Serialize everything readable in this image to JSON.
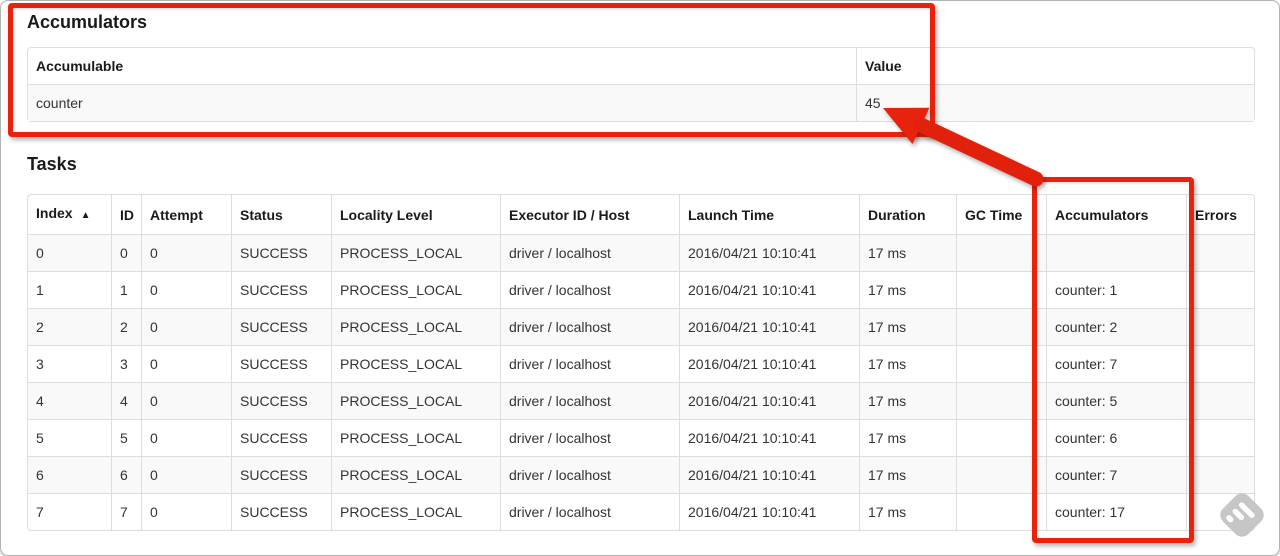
{
  "accumulators_section": {
    "title": "Accumulators",
    "table": {
      "headers": {
        "accumulable": "Accumulable",
        "value": "Value"
      },
      "row": {
        "accumulable": "counter",
        "value": "45"
      }
    }
  },
  "tasks_section": {
    "title": "Tasks",
    "table": {
      "columns": [
        "Index",
        "ID",
        "Attempt",
        "Status",
        "Locality Level",
        "Executor ID / Host",
        "Launch Time",
        "Duration",
        "GC Time",
        "Accumulators",
        "Errors"
      ],
      "sort_icon": "▲",
      "rows": [
        {
          "index": "0",
          "id": "0",
          "attempt": "0",
          "status": "SUCCESS",
          "locality": "PROCESS_LOCAL",
          "executor": "driver / localhost",
          "launch_time": "2016/04/21 10:10:41",
          "duration": "17 ms",
          "gc_time": "",
          "accumulators": "",
          "errors": ""
        },
        {
          "index": "1",
          "id": "1",
          "attempt": "0",
          "status": "SUCCESS",
          "locality": "PROCESS_LOCAL",
          "executor": "driver / localhost",
          "launch_time": "2016/04/21 10:10:41",
          "duration": "17 ms",
          "gc_time": "",
          "accumulators": "counter: 1",
          "errors": ""
        },
        {
          "index": "2",
          "id": "2",
          "attempt": "0",
          "status": "SUCCESS",
          "locality": "PROCESS_LOCAL",
          "executor": "driver / localhost",
          "launch_time": "2016/04/21 10:10:41",
          "duration": "17 ms",
          "gc_time": "",
          "accumulators": "counter: 2",
          "errors": ""
        },
        {
          "index": "3",
          "id": "3",
          "attempt": "0",
          "status": "SUCCESS",
          "locality": "PROCESS_LOCAL",
          "executor": "driver / localhost",
          "launch_time": "2016/04/21 10:10:41",
          "duration": "17 ms",
          "gc_time": "",
          "accumulators": "counter: 7",
          "errors": ""
        },
        {
          "index": "4",
          "id": "4",
          "attempt": "0",
          "status": "SUCCESS",
          "locality": "PROCESS_LOCAL",
          "executor": "driver / localhost",
          "launch_time": "2016/04/21 10:10:41",
          "duration": "17 ms",
          "gc_time": "",
          "accumulators": "counter: 5",
          "errors": ""
        },
        {
          "index": "5",
          "id": "5",
          "attempt": "0",
          "status": "SUCCESS",
          "locality": "PROCESS_LOCAL",
          "executor": "driver / localhost",
          "launch_time": "2016/04/21 10:10:41",
          "duration": "17 ms",
          "gc_time": "",
          "accumulators": "counter: 6",
          "errors": ""
        },
        {
          "index": "6",
          "id": "6",
          "attempt": "0",
          "status": "SUCCESS",
          "locality": "PROCESS_LOCAL",
          "executor": "driver / localhost",
          "launch_time": "2016/04/21 10:10:41",
          "duration": "17 ms",
          "gc_time": "",
          "accumulators": "counter: 7",
          "errors": ""
        },
        {
          "index": "7",
          "id": "7",
          "attempt": "0",
          "status": "SUCCESS",
          "locality": "PROCESS_LOCAL",
          "executor": "driver / localhost",
          "launch_time": "2016/04/21 10:10:41",
          "duration": "17 ms",
          "gc_time": "",
          "accumulators": "counter: 17",
          "errors": ""
        }
      ]
    }
  },
  "annotations": {
    "accent_red": "#e8230d",
    "watermark_gray": "#c6c6c6"
  }
}
